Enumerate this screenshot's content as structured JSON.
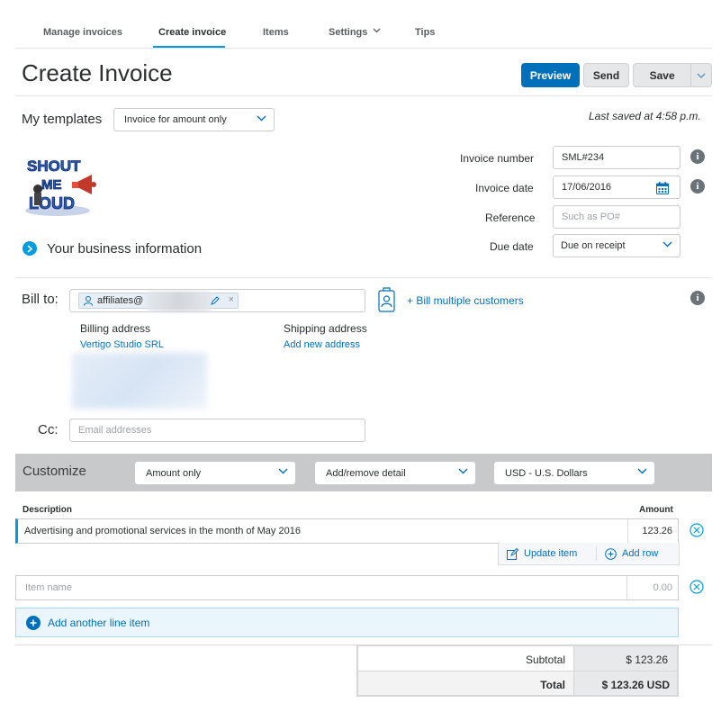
{
  "nav": {
    "items": [
      {
        "label": "Manage invoices"
      },
      {
        "label": "Create invoice"
      },
      {
        "label": "Items"
      },
      {
        "label": "Settings"
      },
      {
        "label": "Tips"
      }
    ]
  },
  "header": {
    "title": "Create Invoice",
    "preview_label": "Preview",
    "send_label": "Send",
    "save_label": "Save"
  },
  "templates": {
    "label": "My templates",
    "selected": "Invoice for amount only",
    "last_saved": "Last saved at 4:58 p.m."
  },
  "logo": {
    "text_lines": [
      "SHOUT",
      "ME",
      "LOUD"
    ]
  },
  "business_info_label": "Your business information",
  "invoice_fields": {
    "number_label": "Invoice number",
    "number_value": "SML#234",
    "date_label": "Invoice date",
    "date_value": "17/06/2016",
    "reference_label": "Reference",
    "reference_placeholder": "Such as PO#",
    "due_label": "Due date",
    "due_value": "Due on receipt"
  },
  "bill_to": {
    "label": "Bill to:",
    "chip_text": "affiliates@",
    "bill_multiple": "+ Bill multiple customers",
    "billing_address_label": "Billing address",
    "billing_name": "Vertigo Studio SRL",
    "shipping_address_label": "Shipping address",
    "add_address_link": "Add new address",
    "cc_label": "Cc:",
    "cc_placeholder": "Email addresses"
  },
  "customize": {
    "label": "Customize",
    "amount_select": "Amount only",
    "detail_select": "Add/remove detail",
    "currency_select": "USD - U.S. Dollars"
  },
  "items": {
    "description_header": "Description",
    "amount_header": "Amount",
    "rows": [
      {
        "description": "Advertising and promotional services in the month of May 2016",
        "amount": "123.26"
      }
    ],
    "update_item_label": "Update item",
    "add_row_label": "Add row",
    "new_item_placeholder": "Item name",
    "new_item_amount_placeholder": "0.00",
    "add_line_label": "Add another line item"
  },
  "totals": {
    "subtotal_label": "Subtotal",
    "subtotal_value": "$ 123.26",
    "total_label": "Total",
    "total_value": "$ 123.26 USD"
  },
  "colors": {
    "primary": "#0070ba",
    "accent": "#009cde",
    "customize_bar": "#c8c9ca"
  }
}
